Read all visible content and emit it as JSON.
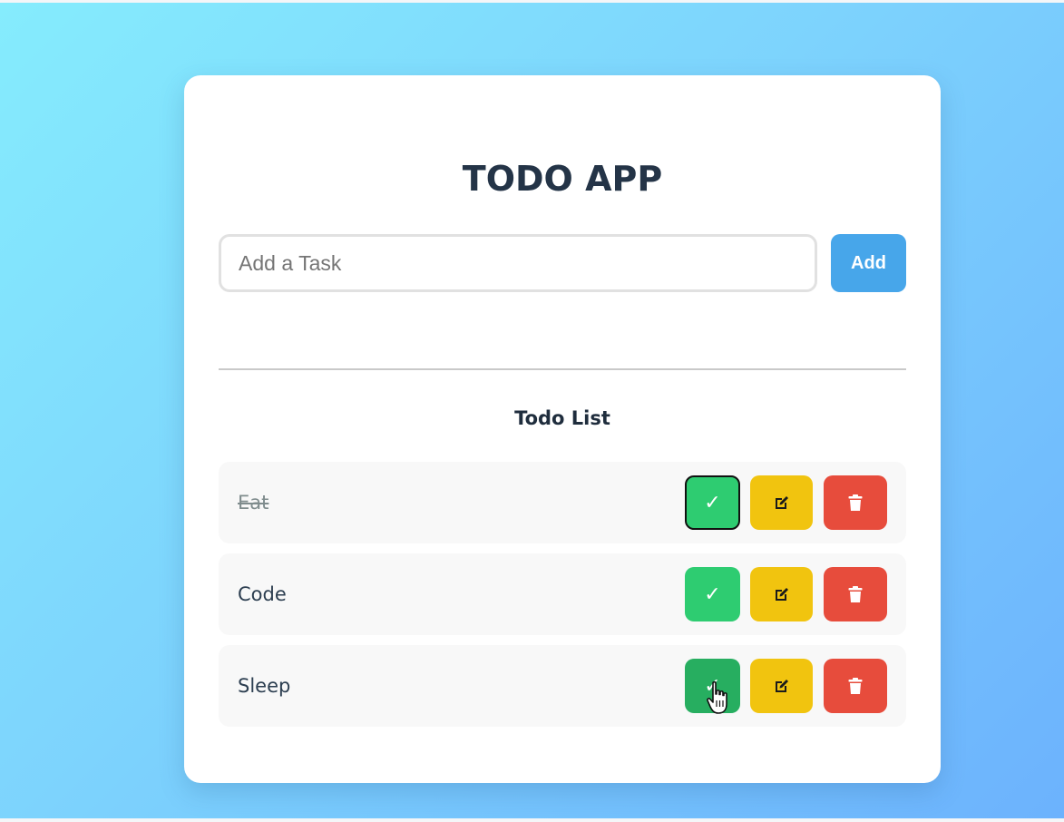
{
  "app": {
    "title": "TODO APP"
  },
  "input": {
    "value": "",
    "placeholder": "Add a Task"
  },
  "add_button": {
    "label": "Add"
  },
  "list": {
    "title": "Todo List",
    "items": [
      {
        "text": "Eat",
        "completed": true,
        "complete_icon": "✓"
      },
      {
        "text": "Code",
        "completed": false,
        "complete_icon": "✓"
      },
      {
        "text": "Sleep",
        "completed": false,
        "complete_icon": "✓"
      }
    ]
  },
  "icons": {
    "complete": "check-icon",
    "edit": "edit-icon",
    "delete": "trash-icon"
  },
  "colors": {
    "accent": "#47a6ea",
    "complete": "#2ecc71",
    "complete_hover": "#27ae60",
    "edit": "#f1c40f",
    "delete": "#e74c3c",
    "heading": "#243447",
    "background_start": "#85ecfd",
    "background_end": "#6cb2fd"
  }
}
